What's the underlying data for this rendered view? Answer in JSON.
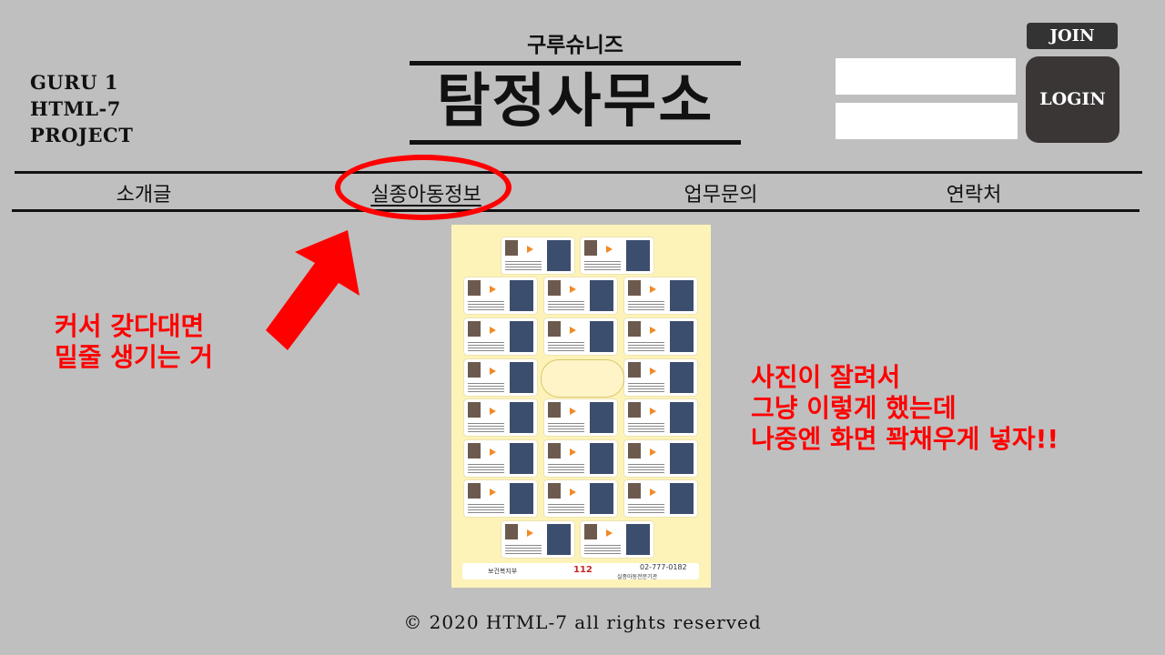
{
  "brand": {
    "line1": "GURU 1",
    "line2": "HTML-7",
    "line3": "PROJECT"
  },
  "header": {
    "subtitle": "구루슈니즈",
    "title": "탐정사무소"
  },
  "auth": {
    "id_value": "",
    "pw_value": "",
    "join_label": "JOIN",
    "login_label": "LOGIN"
  },
  "nav": {
    "items": [
      {
        "label": "소개글"
      },
      {
        "label": "실종아동정보"
      },
      {
        "label": "업무문의"
      },
      {
        "label": "연락처"
      }
    ]
  },
  "annotations": {
    "left_line1": "커서 갖다대면",
    "left_line2": "밑줄 생기는 거",
    "right_line1": "사진이 잘려서",
    "right_line2": "그냥 이렇게 했는데",
    "right_line3": "나중엔 화면 꽉채우게 넣자!!"
  },
  "poster": {
    "phone": "02-777-0182",
    "police_number": "112",
    "org1": "보건복지부",
    "org2": "실종아동전문기관"
  },
  "footer": {
    "copyright": "© 2020 HTML-7 all rights reserved"
  },
  "colors": {
    "background": "#bfbfbf",
    "annotation": "#ff0000",
    "button_dark": "#3a3636",
    "poster_bg": "#fdf3b8"
  }
}
